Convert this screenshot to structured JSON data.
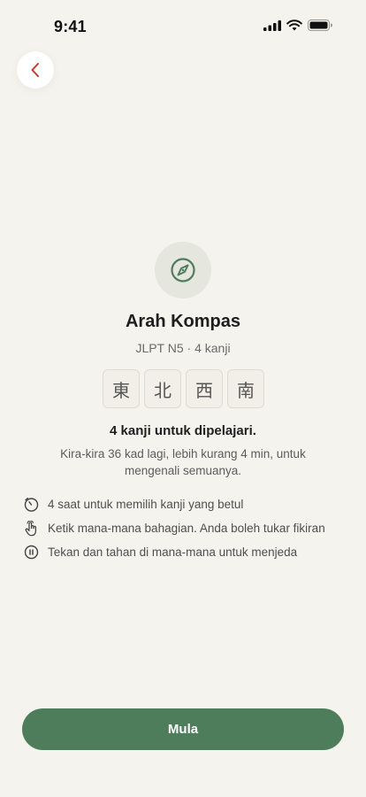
{
  "status_bar": {
    "time": "9:41"
  },
  "header": {
    "back_icon": "chevron-left-icon"
  },
  "hero": {
    "icon": "compass-icon",
    "accent_color": "#4e7d5b"
  },
  "title": "Arah Kompas",
  "subtitle": "JLPT N5 · 4 kanji",
  "kanji": [
    "東",
    "北",
    "西",
    "南"
  ],
  "summary": {
    "heading": "4 kanji untuk dipelajari.",
    "description": "Kira-kira 36 kad lagi, lebih kurang 4 min, untuk mengenali semuanya."
  },
  "tips": [
    {
      "icon": "timer-icon",
      "text": "4 saat untuk memilih kanji yang betul"
    },
    {
      "icon": "tap-hand-icon",
      "text": "Ketik mana-mana bahagian. Anda boleh tukar fikiran"
    },
    {
      "icon": "pause-icon",
      "text": "Tekan dan tahan di mana-mana untuk menjeda"
    }
  ],
  "start_button": {
    "label": "Mula",
    "color": "#4e7d5b"
  }
}
